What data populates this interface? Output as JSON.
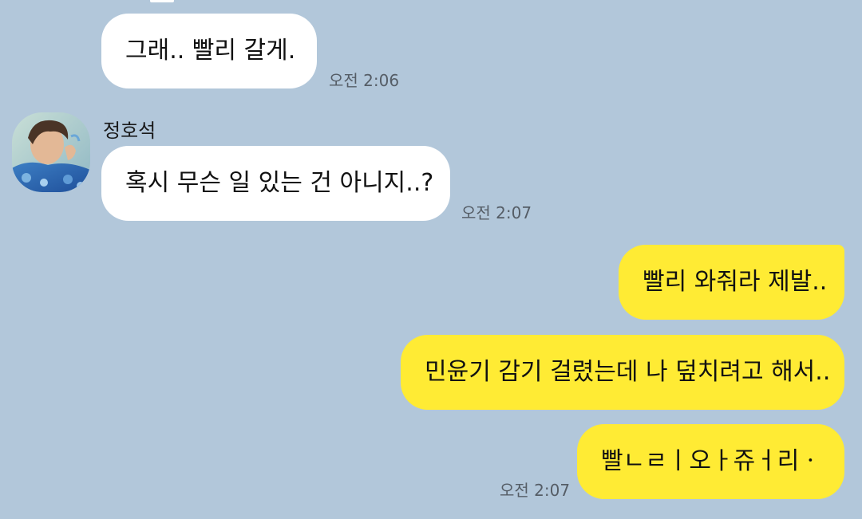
{
  "conversation": {
    "messages": [
      {
        "side": "in",
        "text": "그래.. 빨리 갈게.",
        "time": "오전 2:06"
      },
      {
        "side": "in",
        "sender": "정호석",
        "text": "혹시 무슨 일 있는 건 아니지..?",
        "time": "오전 2:07"
      },
      {
        "side": "out",
        "text": "빨리 와줘라 제발.."
      },
      {
        "side": "out",
        "text": "민윤기 감기 걸렸는데 나 덮치려고 해서.."
      },
      {
        "side": "out",
        "text": "빨ㄴㄹㅣ오ㅏ쥬ㅓ리ㆍ",
        "time": "오전 2:07"
      }
    ]
  },
  "colors": {
    "background": "#b2c7da",
    "incoming_bubble": "#ffffff",
    "outgoing_bubble": "#ffeb34"
  },
  "icons": {
    "avatar": "profile-photo-avatar"
  }
}
